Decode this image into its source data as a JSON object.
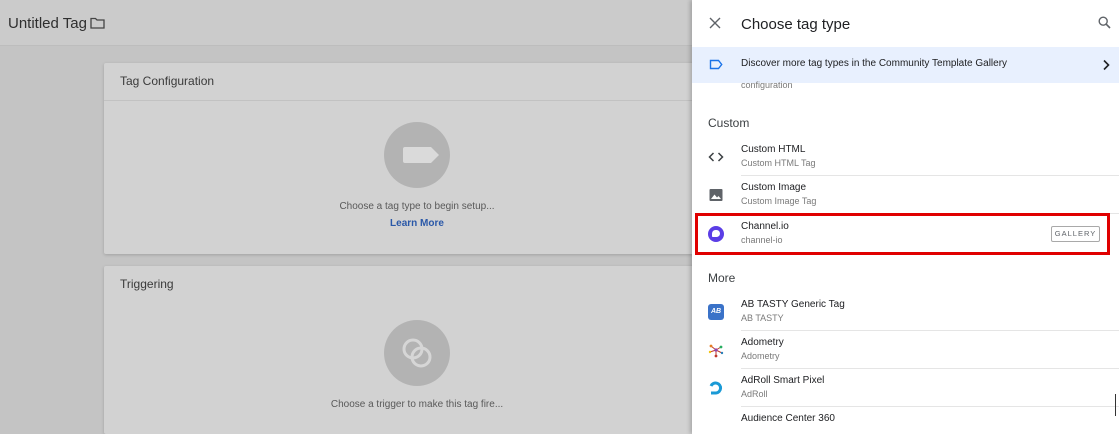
{
  "editor": {
    "tag_title": "Untitled Tag",
    "config_card": {
      "header": "Tag Configuration",
      "hint": "Choose a tag type to begin setup...",
      "learn_more": "Learn More"
    },
    "trigger_card": {
      "header": "Triggering",
      "hint": "Choose a trigger to make this tag fire..."
    }
  },
  "panel": {
    "title": "Choose tag type",
    "banner": {
      "text": "Discover more tag types in the Community Template Gallery"
    },
    "cut_off_text": "configuration",
    "sections": {
      "custom": {
        "label": "Custom",
        "items": [
          {
            "name": "Custom HTML",
            "sub": "Custom HTML Tag",
            "icon": "code-icon"
          },
          {
            "name": "Custom Image",
            "sub": "Custom Image Tag",
            "icon": "image-icon"
          },
          {
            "name": "Channel.io",
            "sub": "channel-io",
            "icon": "channel-io-icon",
            "badge": "GALLERY"
          }
        ]
      },
      "more": {
        "label": "More",
        "items": [
          {
            "name": "AB TASTY Generic Tag",
            "sub": "AB TASTY",
            "icon": "abtasty-icon",
            "icon_text": "AB"
          },
          {
            "name": "Adometry",
            "sub": "Adometry",
            "icon": "adometry-icon"
          },
          {
            "name": "AdRoll Smart Pixel",
            "sub": "AdRoll",
            "icon": "adroll-icon"
          }
        ],
        "partial_item": "Audience Center 360"
      }
    }
  },
  "colors": {
    "accent_blue": "#2a58a8",
    "banner_bg": "#e8f0fe",
    "highlight_red": "#e00000",
    "channel_purple": "#5b3ee6"
  }
}
